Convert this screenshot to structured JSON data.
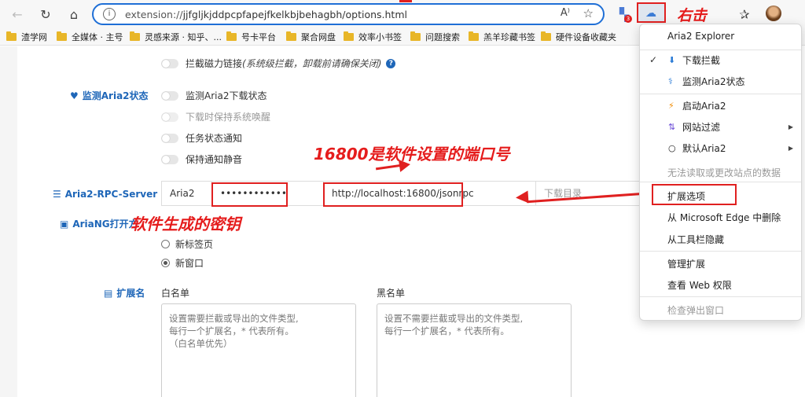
{
  "browser": {
    "url_prefix": "extension://",
    "url_rest": "jjfgljkjddpcpfapejfkelkbjbehagbh/options.html",
    "read_aloud_icon": "A⁾",
    "ext_badge": "3"
  },
  "bookmarks": [
    "渣学网",
    "全媒体 · 主号",
    "灵感来源 · 知乎、...",
    "号卡平台",
    "聚合网盘",
    "效率小书签",
    "问题搜索",
    "羔羊珍藏书签",
    "硬件设备收藏夹"
  ],
  "page": {
    "magnet_toggle": "拦截磁力链接",
    "magnet_note": "(系统级拦截，卸载前请确保关闭)",
    "monitor_label": "监测Aria2状态",
    "monitor_items": [
      "监测Aria2下载状态",
      "下载时保持系统唤醒",
      "任务状态通知",
      "保持通知静音"
    ],
    "rpc_label": "Aria2-RPC-Server",
    "rpc_name": "Aria2",
    "rpc_secret": "••••••••••••",
    "rpc_url": "http://localhost:16800/jsonrpc",
    "rpc_dir_placeholder": "下载目录",
    "ariang_label": "AriaNG打开方",
    "ariang_options": [
      "新标签页",
      "新窗口"
    ],
    "ext_label": "扩展名",
    "whitelist_title": "白名单",
    "blacklist_title": "黑名单",
    "whitelist_placeholder": "设置需要拦截或导出的文件类型,\n每行一个扩展名，* 代表所有。\n（白名单优先）",
    "blacklist_placeholder": "设置不需要拦截或导出的文件类型,\n每行一个扩展名，* 代表所有。"
  },
  "annotations": {
    "right_click": "右击",
    "port_note": "16800是软件设置的端口号",
    "secret_note": "软件生成的密钥"
  },
  "menu": {
    "title": "Aria2 Explorer",
    "items": [
      "下载拦截",
      "监测Aria2状态",
      "启动Aria2",
      "网站过滤",
      "默认Aria2",
      "无法读取或更改站点的数据",
      "扩展选项",
      "从 Microsoft Edge 中删除",
      "从工具栏隐藏",
      "管理扩展",
      "查看 Web 权限",
      "检查弹出窗口"
    ]
  },
  "colors": {
    "accent": "#1e66b8",
    "annotation_red": "#e51c1c",
    "address_border": "#1f6fd6"
  }
}
